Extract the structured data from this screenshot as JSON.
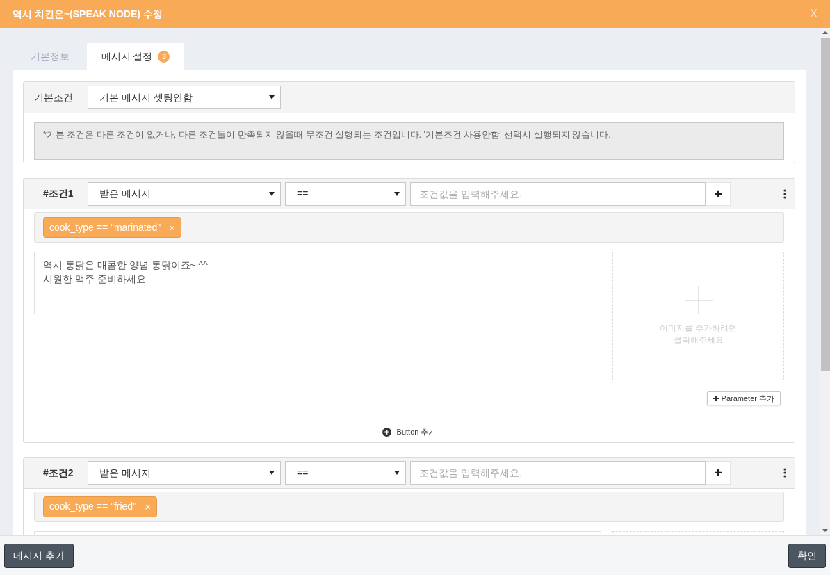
{
  "window": {
    "title": "역시 치킨은~(SPEAK NODE) 수정",
    "close": "X"
  },
  "tabs": [
    {
      "label": "기본정보",
      "selected": false
    },
    {
      "label": "메시지 설정",
      "selected": true,
      "badge": "3"
    }
  ],
  "default_condition": {
    "label": "기본조건",
    "select": "기본 메시지 셋팅안함",
    "note": "*기본 조건은 다른 조건이 없거나, 다른 조건들이 만족되지 않을때 무조건 실행되는 조건입니다. '기본조건 사용안함' 선택시 실행되지 않습니다."
  },
  "conditions": [
    {
      "label": "#조건1",
      "field": "받은 메시지",
      "operator": "==",
      "value_placeholder": "조건값을 입력해주세요.",
      "add": "+",
      "tags": [
        {
          "text": "cook_type == \"marinated\"",
          "remove": "×"
        }
      ],
      "message": "역시 통닭은 매콤한 양념 통닭이죠~ ^^\n시원한 맥주 준비하세요",
      "image_hint": "이미지를 추가하려면\n클릭해주세요",
      "parameter_button": "Parameter 추가",
      "button_add": "Button 추가"
    },
    {
      "label": "#조건2",
      "field": "받은 메시지",
      "operator": "==",
      "value_placeholder": "조건값을 입력해주세요.",
      "add": "+",
      "tags": [
        {
          "text": "cook_type == \"fried\"",
          "remove": "×"
        }
      ]
    }
  ],
  "footer": {
    "left_button": "메시지 추가",
    "right_button": "확인"
  }
}
